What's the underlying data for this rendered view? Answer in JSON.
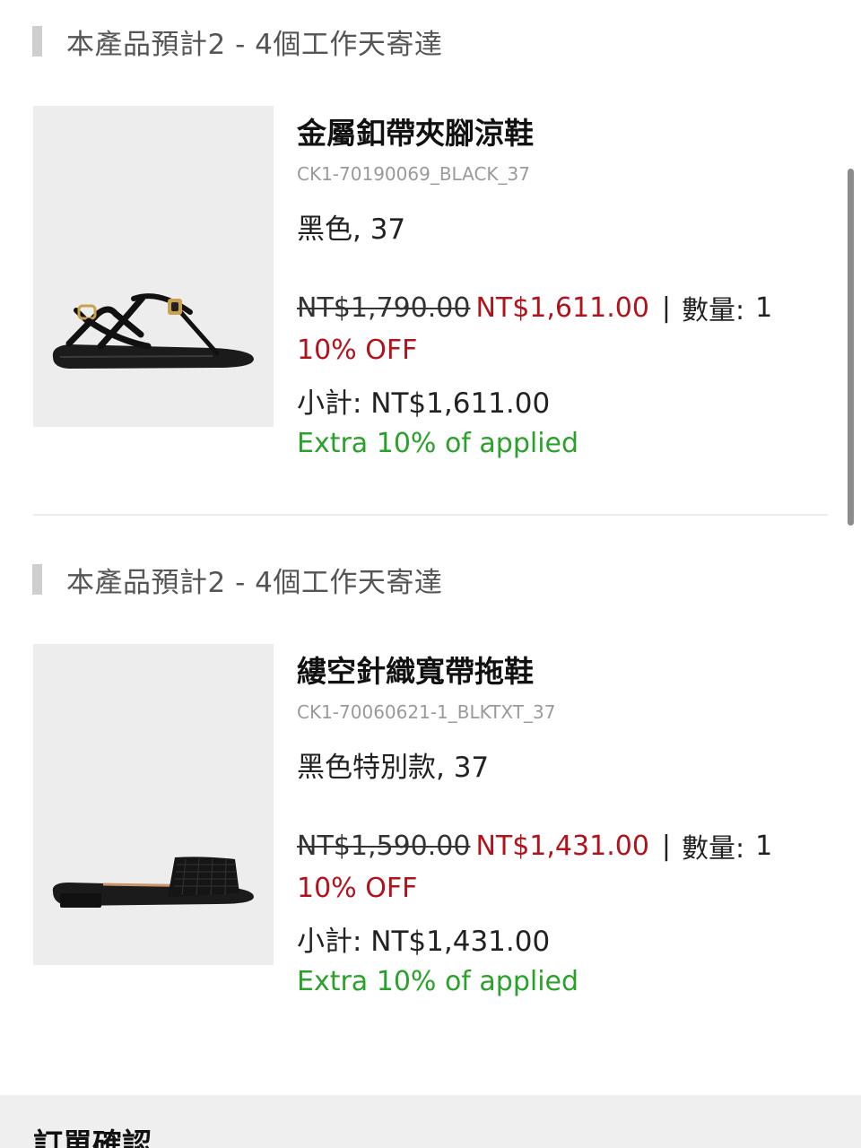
{
  "items": [
    {
      "shipping_note": "本產品預計2 - 4個工作天寄達",
      "name": "金屬釦帶夾腳涼鞋",
      "sku": "CK1-70190069_BLACK_37",
      "variant": "黑色, 37",
      "original_price": "NT$1,790.00",
      "sale_price": "NT$1,611.00",
      "separator": "|",
      "qty_label": "數量:",
      "qty": "1",
      "discount": "10% OFF",
      "subtotal": "小計: NT$1,611.00",
      "extra": "Extra 10% of applied",
      "image_icon": "thong-sandal-image"
    },
    {
      "shipping_note": "本產品預計2 - 4個工作天寄達",
      "name": "縷空針織寬帶拖鞋",
      "sku": "CK1-70060621-1_BLKTXT_37",
      "variant": "黑色特別款, 37",
      "original_price": "NT$1,590.00",
      "sale_price": "NT$1,431.00",
      "separator": "|",
      "qty_label": "數量:",
      "qty": "1",
      "discount": "10% OFF",
      "subtotal": "小計: NT$1,431.00",
      "extra": "Extra 10% of applied",
      "image_icon": "slide-sandal-image"
    }
  ],
  "footer": {
    "title": "訂單確認"
  },
  "colors": {
    "sale_red": "#b3121b",
    "extra_green": "#2aa12a",
    "image_bg": "#ededed"
  }
}
